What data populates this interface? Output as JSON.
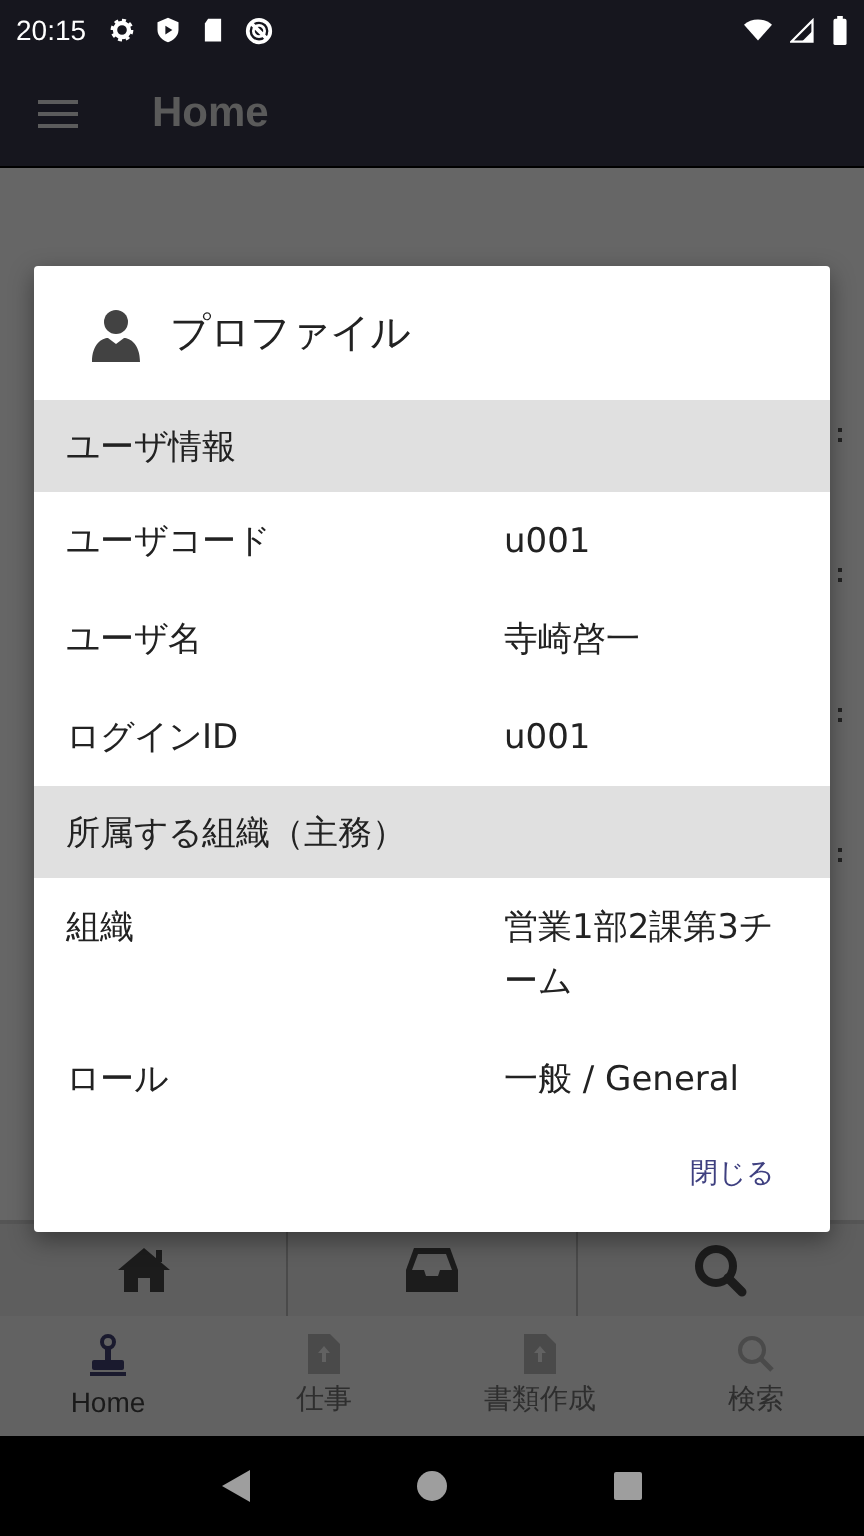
{
  "status_bar": {
    "time": "20:15"
  },
  "app_bar": {
    "title": "Home"
  },
  "dialog": {
    "title": "プロファイル",
    "sections": [
      {
        "title": "ユーザ情報",
        "rows": [
          {
            "label": "ユーザコード",
            "value": "u001"
          },
          {
            "label": "ユーザ名",
            "value": "寺崎啓一"
          },
          {
            "label": "ログインID",
            "value": "u001"
          }
        ]
      },
      {
        "title": "所属する組織（主務）",
        "rows": [
          {
            "label": "組織",
            "value": "営業1部2課第3チーム"
          },
          {
            "label": "ロール",
            "value": "一般 / General"
          }
        ]
      }
    ],
    "close_button": "閉じる"
  },
  "bottom_nav": [
    {
      "label": "Home",
      "kind": "stamp",
      "selected": true
    },
    {
      "label": "仕事",
      "kind": "upload",
      "selected": false
    },
    {
      "label": "書類作成",
      "kind": "upload",
      "selected": false
    },
    {
      "label": "検索",
      "kind": "search",
      "selected": false
    }
  ]
}
